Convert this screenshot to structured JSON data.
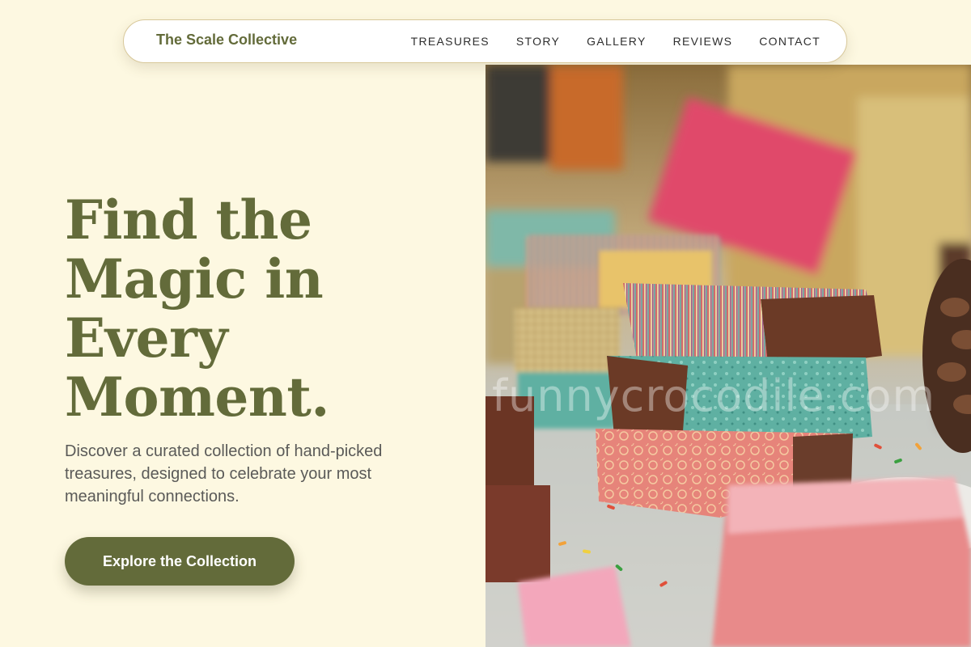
{
  "nav": {
    "brand": "The Scale Collective",
    "links": [
      "TREASURES",
      "STORY",
      "GALLERY",
      "REVIEWS",
      "CONTACT"
    ]
  },
  "hero": {
    "headline_lines": [
      "Find the",
      "Magic in",
      "Every",
      "Moment."
    ],
    "subtext": "Discover a curated collection of hand-picked treasures, designed to celebrate your most meaningful connections.",
    "cta_label": "Explore the Collection",
    "image_watermark": "funnycrocodile.com"
  },
  "colors": {
    "background": "#fdf8e1",
    "accent_olive": "#636b3a",
    "body_text": "#5a5a58",
    "nav_text": "#2e2e2e"
  }
}
